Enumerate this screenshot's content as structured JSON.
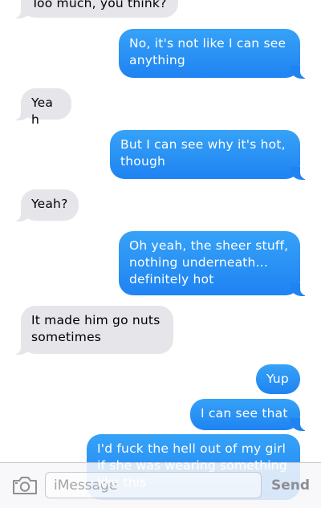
{
  "messages": [
    {
      "from": "them",
      "text": "Too much, you think?"
    },
    {
      "from": "me",
      "text": "No, it's not like I can see anything"
    },
    {
      "from": "them",
      "text": "Yeah"
    },
    {
      "from": "me",
      "text": "But I can see why it's hot, though"
    },
    {
      "from": "them",
      "text": "Yeah?"
    },
    {
      "from": "me",
      "text": "Oh yeah, the sheer stuff, nothing underneath... definitely hot"
    },
    {
      "from": "them",
      "text": "It made him go nuts sometimes"
    },
    {
      "from": "me",
      "text": "Yup"
    },
    {
      "from": "me",
      "text": "I can see that"
    },
    {
      "from": "me",
      "text": "I'd fuck the hell out of my girl if she was wearing something like this"
    }
  ],
  "composer": {
    "placeholder": "iMessage",
    "value": "",
    "send_label": "Send",
    "camera_icon": "camera-icon"
  },
  "colors": {
    "received_bubble": "#e5e5ea",
    "sent_bubble": "#2a93f5",
    "send_label": "#8e8e93"
  }
}
